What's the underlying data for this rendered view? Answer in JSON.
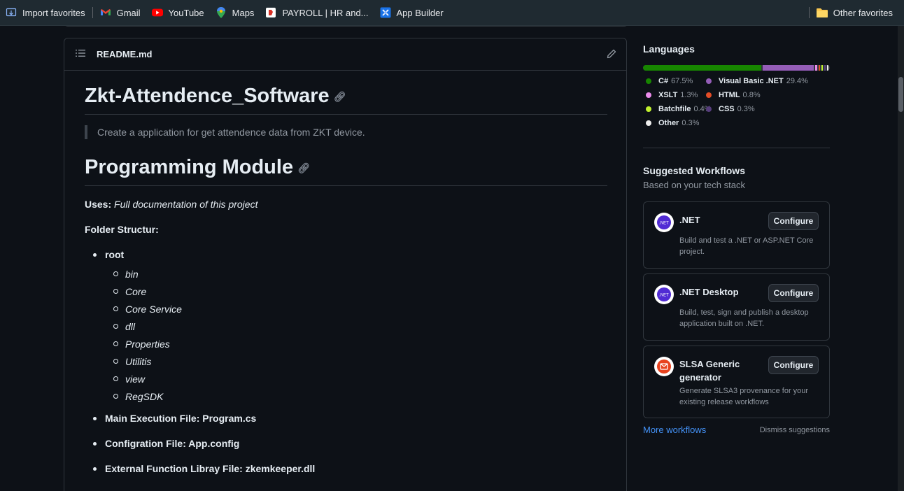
{
  "bookmarks": {
    "items": [
      {
        "label": "Import favorites",
        "icon": "import-icon"
      },
      {
        "label": "Gmail",
        "icon": "gmail-icon"
      },
      {
        "label": "YouTube",
        "icon": "youtube-icon"
      },
      {
        "label": "Maps",
        "icon": "maps-pin-icon"
      },
      {
        "label": "PAYROLL | HR and...",
        "icon": "payroll-icon"
      },
      {
        "label": "App Builder",
        "icon": "app-builder-icon"
      }
    ],
    "other": "Other favorites"
  },
  "readme": {
    "filename": "README.md",
    "title": "Zkt-Attendence_Software",
    "quote": "Create a application for get attendence data from ZKT device.",
    "heading2": "Programming Module",
    "uses_label": "Uses:",
    "uses_value": "Full documentation of this project",
    "folder_label": "Folder Structur:",
    "root_label": "root",
    "subfolders": [
      "bin",
      "Core",
      "Core Service",
      "dll",
      "Properties",
      "Utilitis",
      "view",
      "RegSDK"
    ],
    "main_file": "Main Execution File: Program.cs",
    "config_file": "Configration File: App.config",
    "external_file": "External Function Libray File: zkemkeeper.dll"
  },
  "languages": {
    "title": "Languages",
    "items": [
      {
        "name": "C#",
        "percent": "67.5%",
        "value": 67.5,
        "color": "#178600"
      },
      {
        "name": "Visual Basic .NET",
        "percent": "29.4%",
        "value": 29.4,
        "color": "#945db7"
      },
      {
        "name": "XSLT",
        "percent": "1.3%",
        "value": 1.3,
        "color": "#eb8ceb"
      },
      {
        "name": "HTML",
        "percent": "0.8%",
        "value": 0.8,
        "color": "#e34c26"
      },
      {
        "name": "Batchfile",
        "percent": "0.4%",
        "value": 0.4,
        "color": "#c1f12e"
      },
      {
        "name": "CSS",
        "percent": "0.3%",
        "value": 0.3,
        "color": "#563d7c"
      },
      {
        "name": "Other",
        "percent": "0.3%",
        "value": 0.3,
        "color": "#ededed"
      }
    ]
  },
  "workflows": {
    "title": "Suggested Workflows",
    "subtitle": "Based on your tech stack",
    "cards": [
      {
        "name": ".NET",
        "description": "Build and test a .NET or ASP.NET Core project.",
        "button": "Configure",
        "logo": "dotnet-logo-icon"
      },
      {
        "name": ".NET Desktop",
        "description": "Build, test, sign and publish a desktop application built on .NET.",
        "button": "Configure",
        "logo": "dotnet-logo-icon"
      },
      {
        "name": "SLSA Generic generator",
        "description": "Generate SLSA3 provenance for your existing release workflows",
        "button": "Configure",
        "logo": "slsa-logo-icon"
      }
    ],
    "more": "More workflows",
    "dismiss": "Dismiss suggestions"
  }
}
